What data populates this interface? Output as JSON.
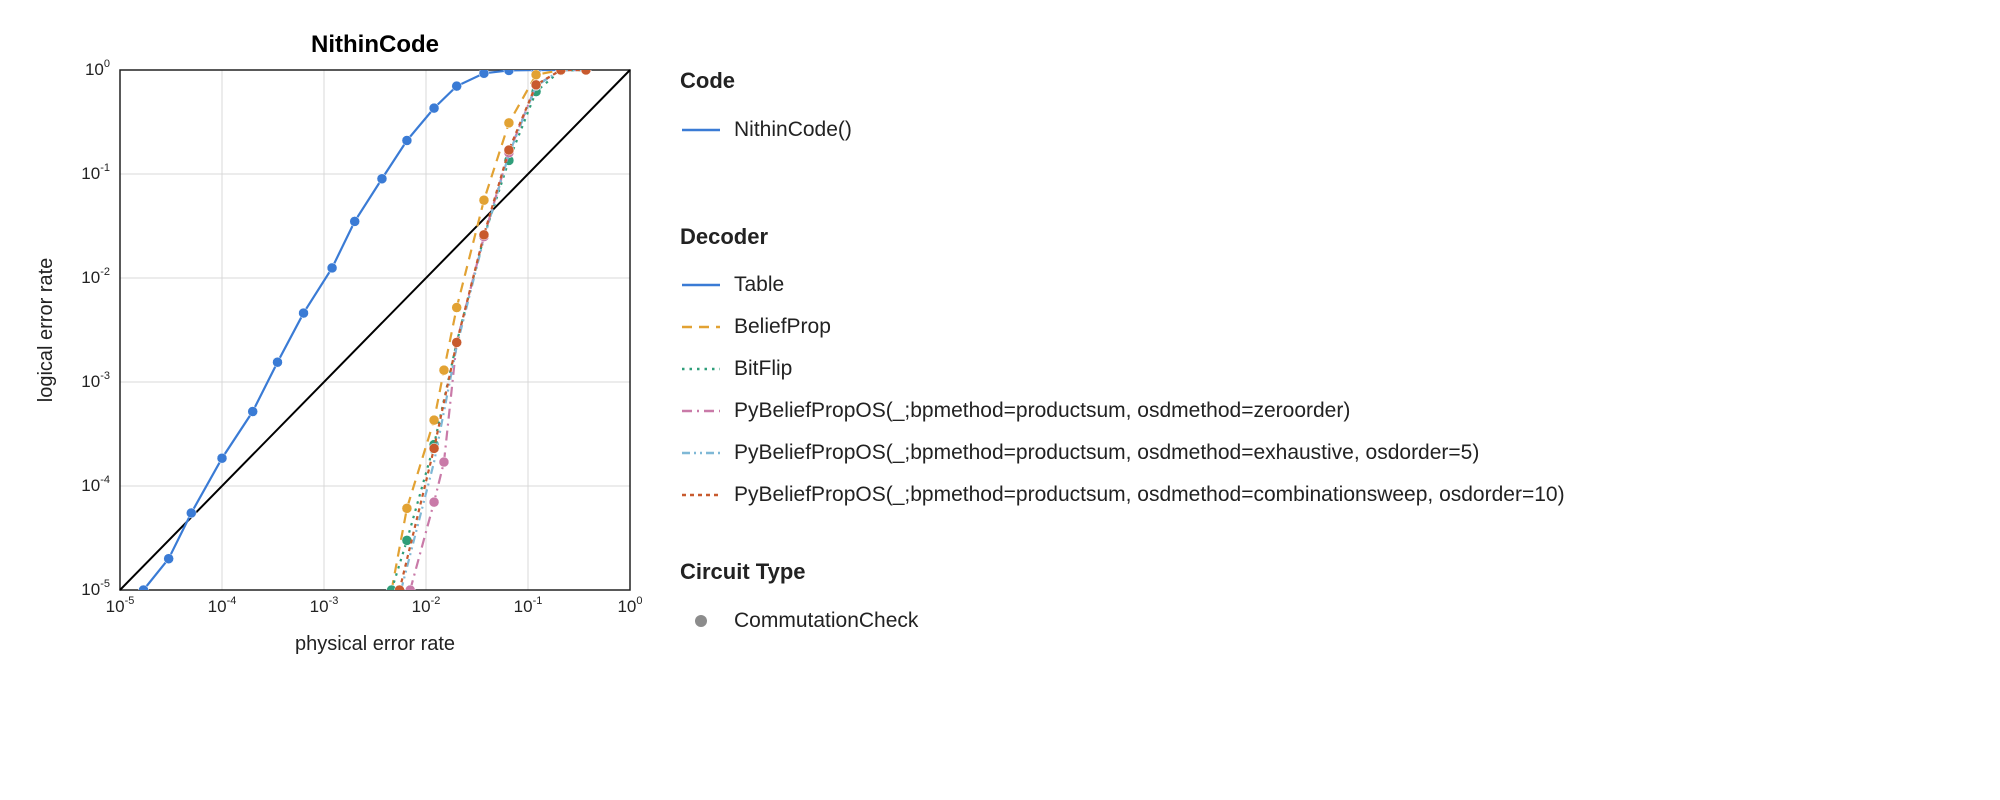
{
  "chart_data": {
    "type": "scatter",
    "title": "NithinCode",
    "xlabel": "physical error rate",
    "ylabel": "logical error rate",
    "xlim": [
      1e-05,
      1
    ],
    "ylim": [
      1e-05,
      1
    ],
    "xscale": "log",
    "yscale": "log",
    "ticks": [
      1e-05,
      0.0001,
      0.001,
      0.01,
      0.1,
      1
    ],
    "ticklabels": [
      "10⁻⁵",
      "10⁻⁴",
      "10⁻³",
      "10⁻²",
      "10⁻¹",
      "10⁰"
    ],
    "diagonal": {
      "x0": 1e-05,
      "y0": 1e-05,
      "x1": 1,
      "y1": 1
    },
    "series": [
      {
        "name": "Table",
        "color": "#3a7bd5",
        "dash": "solid",
        "marker": true,
        "points": [
          {
            "x": 1.7e-05,
            "y": 1e-05
          },
          {
            "x": 3e-05,
            "y": 2e-05
          },
          {
            "x": 5e-05,
            "y": 5.5e-05
          },
          {
            "x": 0.0001,
            "y": 0.000185
          },
          {
            "x": 0.0002,
            "y": 0.00052
          },
          {
            "x": 0.00035,
            "y": 0.00155
          },
          {
            "x": 0.00063,
            "y": 0.0046
          },
          {
            "x": 0.0012,
            "y": 0.0125
          },
          {
            "x": 0.002,
            "y": 0.035
          },
          {
            "x": 0.0037,
            "y": 0.09
          },
          {
            "x": 0.0065,
            "y": 0.21
          },
          {
            "x": 0.012,
            "y": 0.43
          },
          {
            "x": 0.02,
            "y": 0.7
          },
          {
            "x": 0.037,
            "y": 0.93
          },
          {
            "x": 0.065,
            "y": 0.99
          },
          {
            "x": 0.12,
            "y": 1.0
          },
          {
            "x": 0.21,
            "y": 1.0
          },
          {
            "x": 0.37,
            "y": 1.0
          }
        ]
      },
      {
        "name": "BeliefProp",
        "color": "#e2a233",
        "dash": "dashed",
        "marker": true,
        "points": [
          {
            "x": 0.0046,
            "y": 1e-05
          },
          {
            "x": 0.0065,
            "y": 6.1e-05
          },
          {
            "x": 0.012,
            "y": 0.00043
          },
          {
            "x": 0.015,
            "y": 0.0013
          },
          {
            "x": 0.02,
            "y": 0.0052
          },
          {
            "x": 0.037,
            "y": 0.056
          },
          {
            "x": 0.065,
            "y": 0.31
          },
          {
            "x": 0.12,
            "y": 0.9
          },
          {
            "x": 0.21,
            "y": 1.0
          },
          {
            "x": 0.37,
            "y": 1.0
          }
        ]
      },
      {
        "name": "BitFlip",
        "color": "#2f9e7a",
        "dash": "dotted",
        "marker": true,
        "points": [
          {
            "x": 0.0046,
            "y": 1e-05
          },
          {
            "x": 0.0065,
            "y": 3e-05
          },
          {
            "x": 0.012,
            "y": 0.00025
          },
          {
            "x": 0.02,
            "y": 0.0024
          },
          {
            "x": 0.037,
            "y": 0.025
          },
          {
            "x": 0.065,
            "y": 0.135
          },
          {
            "x": 0.12,
            "y": 0.62
          },
          {
            "x": 0.21,
            "y": 0.99
          },
          {
            "x": 0.37,
            "y": 1.0
          }
        ]
      },
      {
        "name": "PyBeliefPropOS(_;bpmethod=productsum, osdmethod=zeroorder)",
        "color": "#c97aa8",
        "dash": "dashdot",
        "marker": true,
        "points": [
          {
            "x": 0.007,
            "y": 1e-05
          },
          {
            "x": 0.012,
            "y": 7e-05
          },
          {
            "x": 0.015,
            "y": 0.00017
          },
          {
            "x": 0.02,
            "y": 0.0024
          },
          {
            "x": 0.037,
            "y": 0.025
          },
          {
            "x": 0.065,
            "y": 0.16
          },
          {
            "x": 0.12,
            "y": 0.71
          },
          {
            "x": 0.21,
            "y": 1.0
          },
          {
            "x": 0.37,
            "y": 1.0
          }
        ]
      },
      {
        "name": "PyBeliefPropOS(_;bpmethod=productsum, osdmethod=exhaustive, osdorder=5)",
        "color": "#7fb8d6",
        "dash": "dashdot2",
        "marker": false,
        "points": [
          {
            "x": 0.0057,
            "y": 1e-05
          },
          {
            "x": 0.012,
            "y": 0.00017
          },
          {
            "x": 0.02,
            "y": 0.0022
          },
          {
            "x": 0.037,
            "y": 0.024
          },
          {
            "x": 0.065,
            "y": 0.155
          },
          {
            "x": 0.12,
            "y": 0.7
          },
          {
            "x": 0.21,
            "y": 1.0
          },
          {
            "x": 0.37,
            "y": 1.0
          }
        ]
      },
      {
        "name": "PyBeliefPropOS(_;bpmethod=productsum, osdmethod=combinationsweep, osdorder=10)",
        "color": "#c85a2e",
        "dash": "shortdash",
        "marker": true,
        "points": [
          {
            "x": 0.0055,
            "y": 1e-05
          },
          {
            "x": 0.012,
            "y": 0.00023
          },
          {
            "x": 0.02,
            "y": 0.0024
          },
          {
            "x": 0.037,
            "y": 0.026
          },
          {
            "x": 0.065,
            "y": 0.17
          },
          {
            "x": 0.12,
            "y": 0.72
          },
          {
            "x": 0.21,
            "y": 1.0
          },
          {
            "x": 0.37,
            "y": 1.0
          }
        ]
      }
    ]
  },
  "legend": {
    "code_title": "Code",
    "code_items": [
      {
        "label": "NithinCode()",
        "color": "#3a7bd5",
        "dash": "solid"
      }
    ],
    "decoder_title": "Decoder",
    "decoder_items": [
      {
        "label": "Table",
        "color": "#3a7bd5",
        "dash": "solid"
      },
      {
        "label": "BeliefProp",
        "color": "#e2a233",
        "dash": "dashed"
      },
      {
        "label": "BitFlip",
        "color": "#2f9e7a",
        "dash": "dotted"
      },
      {
        "label": "PyBeliefPropOS(_;bpmethod=productsum, osdmethod=zeroorder)",
        "color": "#c97aa8",
        "dash": "dashdot"
      },
      {
        "label": "PyBeliefPropOS(_;bpmethod=productsum, osdmethod=exhaustive, osdorder=5)",
        "color": "#7fb8d6",
        "dash": "dashdot2"
      },
      {
        "label": "PyBeliefPropOS(_;bpmethod=productsum, osdmethod=combinationsweep, osdorder=10)",
        "color": "#c85a2e",
        "dash": "shortdash"
      }
    ],
    "circuit_title": "Circuit Type",
    "circuit_items": [
      {
        "label": "CommutationCheck",
        "color": "#8c8c8c",
        "marker": "circle"
      }
    ]
  }
}
